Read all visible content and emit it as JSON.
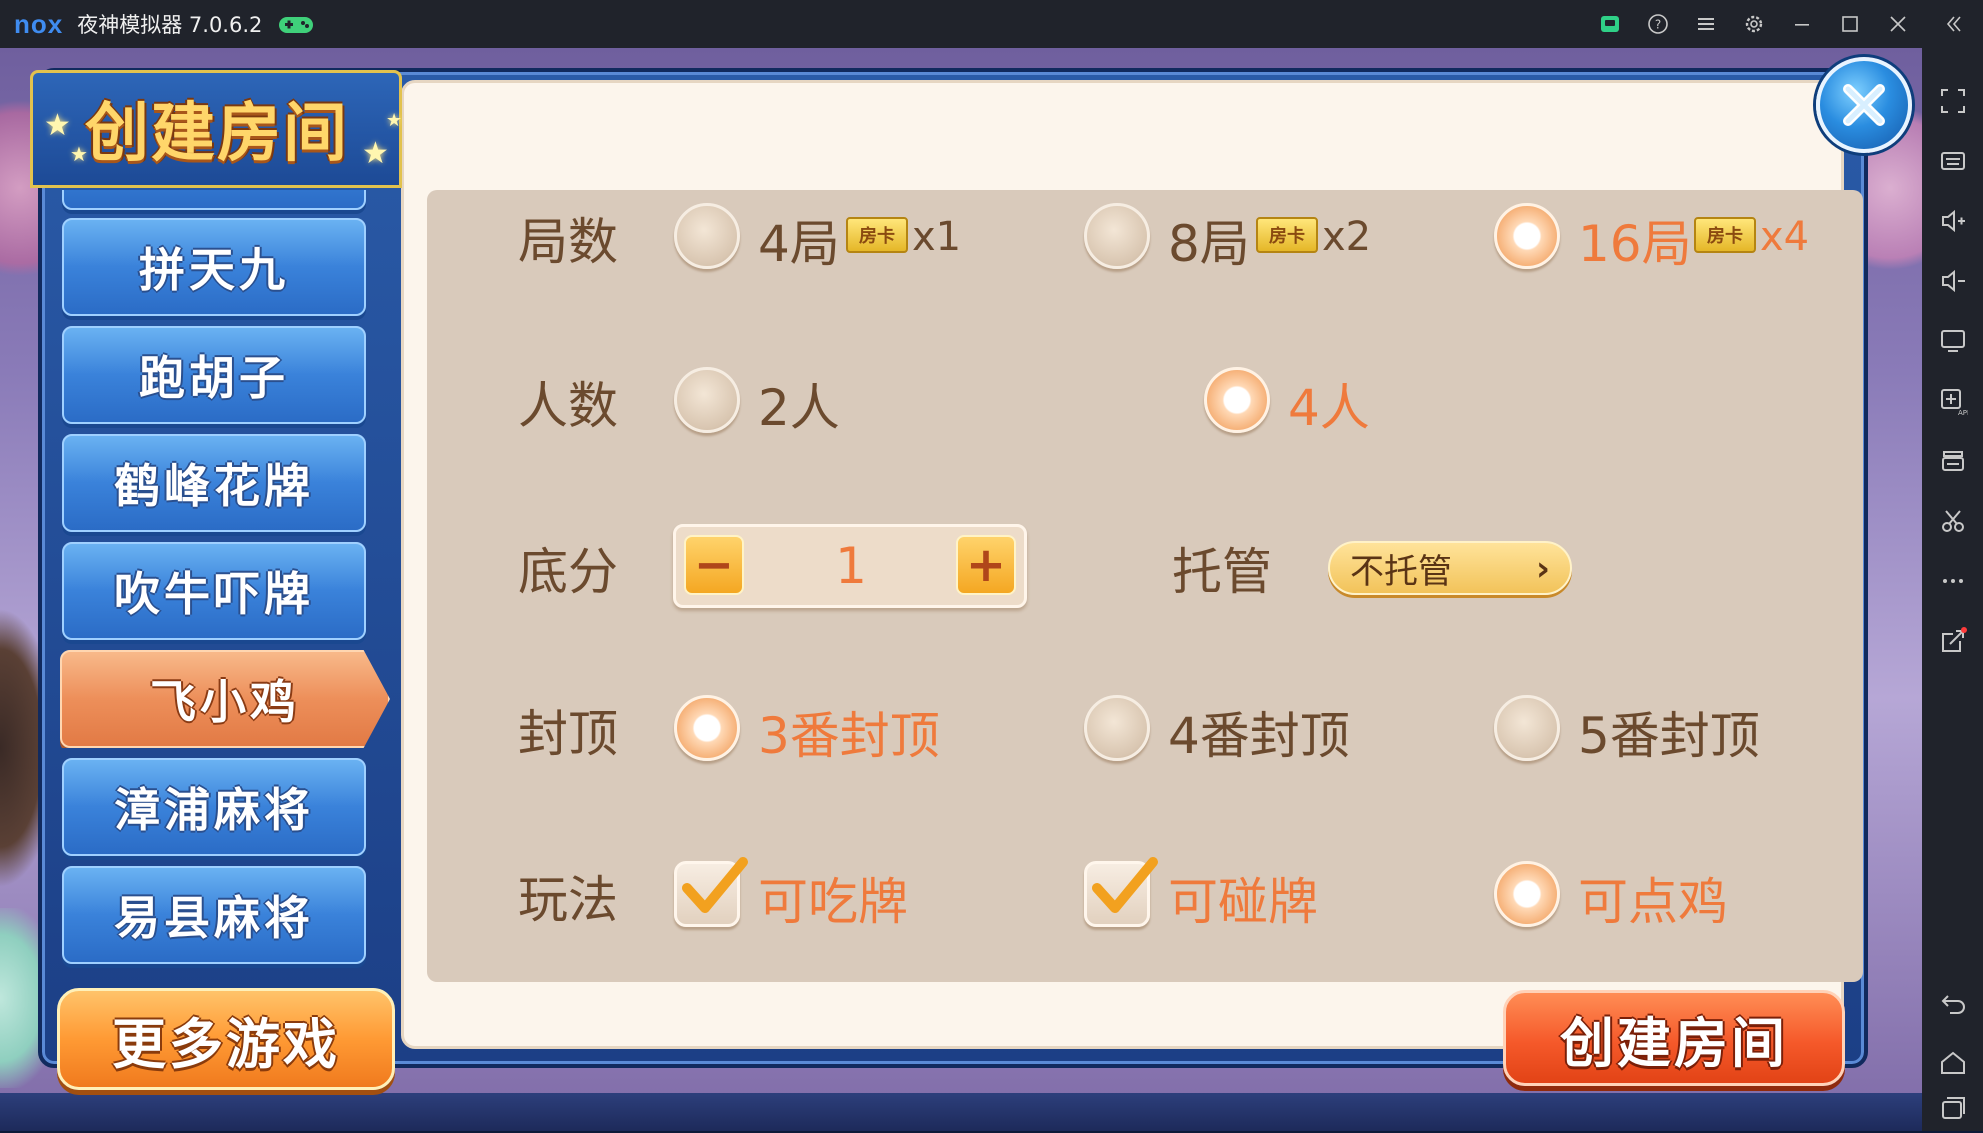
{
  "titlebar": {
    "logo": "nox",
    "title": "夜神模拟器 7.0.6.2",
    "buttons": [
      "gift-icon",
      "help-icon",
      "menu-icon",
      "settings-icon",
      "minimize-icon",
      "maximize-icon",
      "close-icon",
      "collapse-icon"
    ]
  },
  "sidebar": {
    "buttons": [
      "fullscreen-icon",
      "keyboard-icon",
      "volume-up-icon",
      "volume-down-icon",
      "screen-icon",
      "apk-icon",
      "multi-instance-icon",
      "screenshot-icon",
      "more-icon",
      "share-icon",
      "back-icon",
      "home-icon",
      "recents-icon"
    ]
  },
  "dialog": {
    "title": "创建房间",
    "games": [
      "拼天九",
      "跑胡子",
      "鹤峰花牌",
      "吹牛吓牌",
      "飞小鸡",
      "漳浦麻将",
      "易县麻将"
    ],
    "active_game": "飞小鸡",
    "more_games": "更多游戏",
    "create_button": "创建房间"
  },
  "options": {
    "rounds": {
      "label": "局数",
      "choices": [
        {
          "text": "4局",
          "badge": "房卡",
          "mult": "x1",
          "selected": false
        },
        {
          "text": "8局",
          "badge": "房卡",
          "mult": "x2",
          "selected": false
        },
        {
          "text": "16局",
          "badge": "房卡",
          "mult": "x4",
          "selected": true
        }
      ]
    },
    "players": {
      "label": "人数",
      "choices": [
        {
          "text": "2人",
          "selected": false
        },
        {
          "text": "4人",
          "selected": true
        }
      ]
    },
    "base_score": {
      "label": "底分",
      "value": "1",
      "minus": "−",
      "plus": "+"
    },
    "auto_play": {
      "label": "托管",
      "value": "不托管",
      "chevron": "›"
    },
    "cap": {
      "label": "封顶",
      "choices": [
        {
          "text": "3番封顶",
          "selected": true
        },
        {
          "text": "4番封顶",
          "selected": false
        },
        {
          "text": "5番封顶",
          "selected": false
        }
      ]
    },
    "rules": {
      "label": "玩法",
      "choices": [
        {
          "text": "可吃牌",
          "checked": true,
          "kind": "checkbox"
        },
        {
          "text": "可碰牌",
          "checked": true,
          "kind": "checkbox"
        },
        {
          "text": "可点鸡",
          "checked": true,
          "kind": "radio"
        }
      ]
    }
  },
  "colors": {
    "selected_text": "#ef7a3c",
    "normal_text": "#6b4a2e",
    "panel_bg": "#fcf5ec",
    "options_bg": "#d9cabb"
  }
}
